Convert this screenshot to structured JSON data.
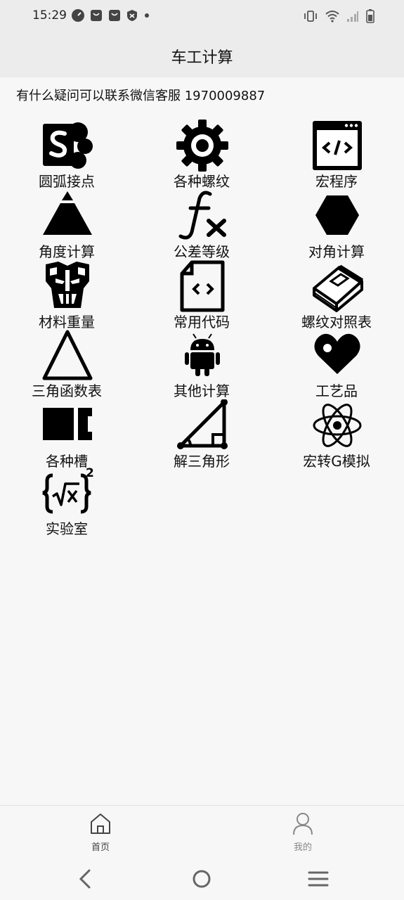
{
  "status": {
    "time": "15:29"
  },
  "appbar": {
    "title": "车工计算"
  },
  "notice": "有什么疑问可以联系微信客服 1970009887",
  "tiles": [
    {
      "label": "圆弧接点",
      "icon": "sharepoint-icon"
    },
    {
      "label": "各种螺纹",
      "icon": "gear-icon"
    },
    {
      "label": "宏程序",
      "icon": "code-window-icon"
    },
    {
      "label": "角度计算",
      "icon": "pyramid-icon"
    },
    {
      "label": "公差等级",
      "icon": "function-fx-icon"
    },
    {
      "label": "对角计算",
      "icon": "hexagon-icon"
    },
    {
      "label": "材料重量",
      "icon": "transformer-icon"
    },
    {
      "label": "常用代码",
      "icon": "code-file-icon"
    },
    {
      "label": "螺纹对照表",
      "icon": "book-icon"
    },
    {
      "label": "三角函数表",
      "icon": "triangle-outline-icon"
    },
    {
      "label": "其他计算",
      "icon": "android-icon"
    },
    {
      "label": "工艺品",
      "icon": "heart-icon"
    },
    {
      "label": "各种槽",
      "icon": "slot-block-icon"
    },
    {
      "label": "解三角形",
      "icon": "right-triangle-icon"
    },
    {
      "label": "宏转G模拟",
      "icon": "atom-icon"
    },
    {
      "label": "实验室",
      "icon": "sqrt-formula-icon"
    }
  ],
  "bottom_nav": {
    "home_label": "首页",
    "mine_label": "我的"
  },
  "colors": {
    "active": "#444444",
    "inactive": "#888888",
    "appbar": "#ececec"
  }
}
